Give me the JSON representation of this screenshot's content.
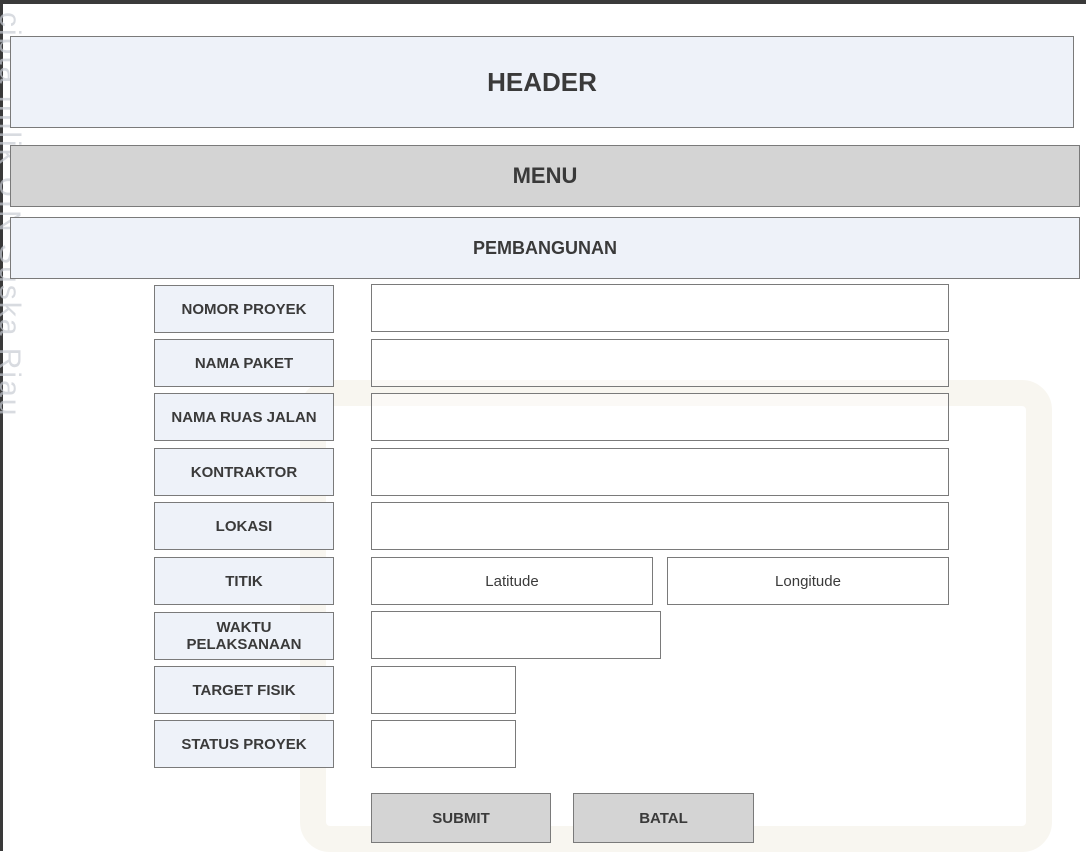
{
  "watermark": "cipta milik UIN Suska Riau",
  "header": {
    "title": "HEADER"
  },
  "menu": {
    "title": "MENU"
  },
  "section": {
    "title": "PEMBANGUNAN"
  },
  "form": {
    "fields": [
      {
        "label": "NOMOR PROYEK",
        "value": ""
      },
      {
        "label": "NAMA PAKET",
        "value": ""
      },
      {
        "label": "NAMA RUAS JALAN",
        "value": ""
      },
      {
        "label": "KONTRAKTOR",
        "value": ""
      },
      {
        "label": "LOKASI",
        "value": ""
      },
      {
        "label": "TITIK",
        "latitude_placeholder": "Latitude",
        "longitude_placeholder": "Longitude"
      },
      {
        "label": "WAKTU PELAKSANAAN",
        "value": ""
      },
      {
        "label": "TARGET FISIK",
        "value": ""
      },
      {
        "label": "STATUS PROYEK",
        "value": ""
      }
    ]
  },
  "actions": {
    "submit_label": "SUBMIT",
    "cancel_label": "BATAL"
  }
}
